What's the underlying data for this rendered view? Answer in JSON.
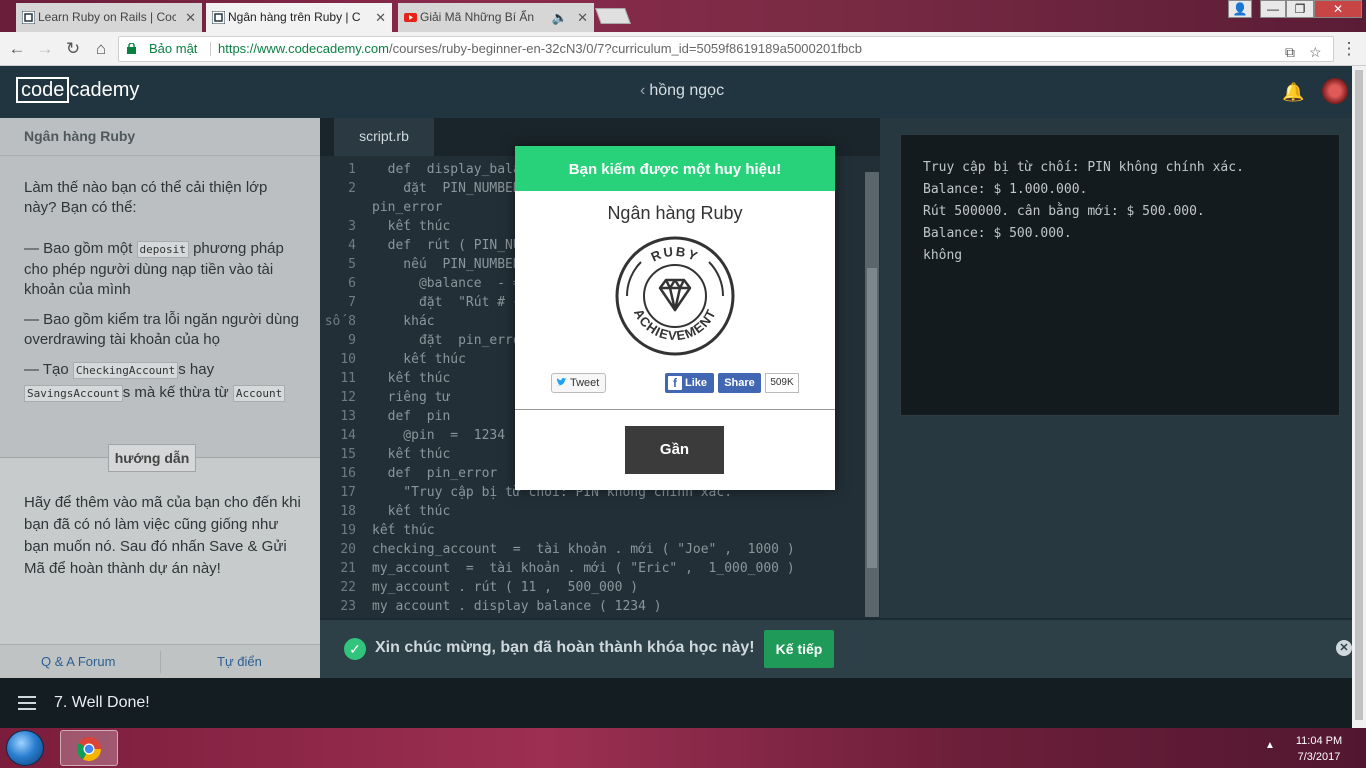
{
  "browser": {
    "tabs": [
      {
        "title": "Learn Ruby on Rails | Coc",
        "icon": "codecademy-icon",
        "active": false
      },
      {
        "title": "Ngân hàng trên Ruby | C",
        "icon": "codecademy-icon",
        "active": true
      },
      {
        "title": "Giải Mã Những Bí Ẩn",
        "icon": "youtube-icon",
        "active": false
      }
    ],
    "secure_label": "Bảo mật",
    "url_host": "https://www.codecademy.com",
    "url_path": "/courses/ruby-beginner-en-32cN3/0/7?curriculum_id=5059f8619189a5000201fbcb"
  },
  "header": {
    "logo_left": "code",
    "logo_right": "cademy",
    "breadcrumb": "hồng ngọc"
  },
  "instructions": {
    "title": "Ngân hàng Ruby",
    "intro": "Làm thế nào bạn có thể cải thiện lớp này? Bạn có thể:",
    "item1_pre": "— Bao gồm một ",
    "item1_code": "deposit",
    "item1_post": " phương pháp cho phép người dùng nạp tiền vào tài khoản của mình",
    "item2": "— Bao gồm kiểm tra lỗi ngăn người dùng overdrawing tài khoản của họ",
    "item3_pre": "— Tạo ",
    "item3_code1": "CheckingAccount",
    "item3_mid": "s hay ",
    "item3_code2": "SavingsAccount",
    "item3_mid2": "s mà kế thừa từ ",
    "item3_code3": "Account",
    "hint_label": "hướng dẫn",
    "lower_text": "Hãy để thêm vào mã của bạn cho đến khi bạn đã có nó làm việc cũng giống như bạn muốn nó. Sau đó nhấn Save & Gửi Mã để hoàn thành dự án này!",
    "forum_link": "Q & A Forum",
    "glossary_link": "Tự điển"
  },
  "editor": {
    "tab": "script.rb",
    "lines": [
      {
        "n": "1",
        "text": "  def  display_bala"
      },
      {
        "n": "2",
        "text": "    đặt  PIN_NUMBER"
      },
      {
        "n": "",
        "text": "pin_error"
      },
      {
        "n": "3",
        "text": "  kết thúc"
      },
      {
        "n": "4",
        "text": "  def  rút ( PIN_NU"
      },
      {
        "n": "5",
        "text": "    nếu  PIN_NUMBER"
      },
      {
        "n": "6",
        "text": "      @balance  - ="
      },
      {
        "n": "7",
        "text": "      đặt  \"Rút # {"
      },
      {
        "n": "số 8",
        "text": "    khác"
      },
      {
        "n": "9",
        "text": "      đặt  pin_error"
      },
      {
        "n": "10",
        "text": "    kết thúc"
      },
      {
        "n": "11",
        "text": "  kết thúc"
      },
      {
        "n": "12",
        "text": "  riêng tư"
      },
      {
        "n": "13",
        "text": "  def  pin"
      },
      {
        "n": "14",
        "text": "    @pin  =  1234"
      },
      {
        "n": "15",
        "text": "  kết thúc"
      },
      {
        "n": "16",
        "text": "  def  pin_error"
      },
      {
        "n": "17",
        "text": "    \"Truy cập bị từ chối: PIN không chính xác.\""
      },
      {
        "n": "18",
        "text": "  kết thúc"
      },
      {
        "n": "19",
        "text": "kết thúc"
      },
      {
        "n": "20",
        "text": "checking_account  =  tài khoản . mới ( \"Joe\" ,  1000 )"
      },
      {
        "n": "21",
        "text": "my_account  =  tài khoản . mới ( \"Eric\" ,  1_000_000 )"
      },
      {
        "n": "22",
        "text": "my_account . rút ( 11 ,  500_000 )"
      },
      {
        "n": "23",
        "text": "my account . display balance ( 1234 )"
      }
    ]
  },
  "console": {
    "lines": [
      "Truy cập bị từ chối: PIN không chính xác.",
      "Balance: $ 1.000.000.",
      "Rút 500000. cân bằng mới: $ 500.000.",
      "Balance: $ 500.000.",
      "không"
    ]
  },
  "congrats": {
    "text": "Xin chúc mừng, bạn đã hoàn thành khóa học này!",
    "next_label": "Kế tiếp"
  },
  "bottom": {
    "lesson": "7. Well Done!"
  },
  "modal": {
    "header": "Bạn kiếm được một huy hiệu!",
    "title": "Ngân hàng Ruby",
    "badge_top": "RUBY",
    "badge_bottom": "ACHIEVEMENT",
    "tweet_label": "Tweet",
    "like_label": "Like",
    "share_label": "Share",
    "share_count": "509K",
    "close_label": "Gần"
  },
  "taskbar": {
    "time": "11:04 PM",
    "date": "7/3/2017"
  },
  "colors": {
    "accent_green": "#27d27a",
    "header_bg": "#203540",
    "next_green": "#1f9a58"
  }
}
